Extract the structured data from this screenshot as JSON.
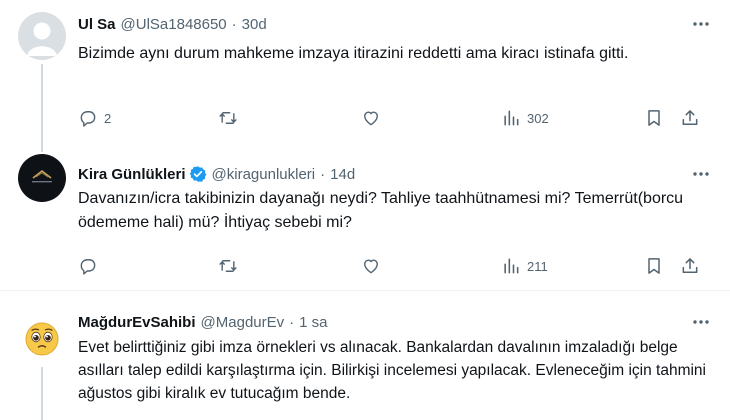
{
  "tweets": [
    {
      "name": "Ul Sa",
      "handle": "@UlSa1848650",
      "sep": "·",
      "time": "30d",
      "verified": false,
      "avatar_icon": "default-user-avatar",
      "text": "Bizimde aynı durum mahkeme imzaya itirazini reddetti ama kiracı istinafa gitti.",
      "replies": "2",
      "retweets": "",
      "likes": "",
      "views": "302"
    },
    {
      "name": "Kira Günlükleri",
      "handle": "@kiragunlukleri",
      "sep": "·",
      "time": "14d",
      "verified": true,
      "verified_color": "#1d9bf0",
      "avatar_icon": "dark-logo-avatar",
      "text": "Davanızın/icra takibinizin dayanağı neydi? Tahliye taahhütnamesi mi? Temerrüt(borcu ödememe hali) mü? İhtiyaç sebebi mi?",
      "replies": "",
      "retweets": "",
      "likes": "",
      "views": "211"
    },
    {
      "name": "MağdurEvSahibi",
      "handle": "@MagdurEv",
      "sep": "·",
      "time": "1 sa",
      "verified": false,
      "avatar_icon": "pleading-face-emoji-avatar",
      "text": "Evet belirttiğiniz gibi imza örnekleri vs alınacak. Bankalardan davalının imzaladığı belge asılları talep edildi karşılaştırma için. Bilirkişi incelemesi yapılacak. Evleneceğim için tahmini ağustos gibi kiralık ev tutucağım bende."
    }
  ],
  "colors": {
    "text": "#0f1419",
    "muted": "#536471",
    "line": "#cfd9de",
    "accent": "#1d9bf0"
  }
}
